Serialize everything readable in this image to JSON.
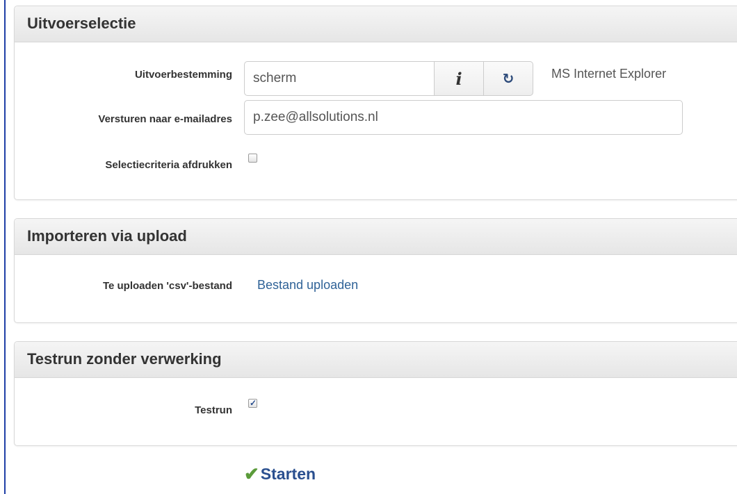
{
  "output_selection": {
    "title": "Uitvoerselectie",
    "destination_label": "Uitvoerbestemming",
    "destination_value": "scherm",
    "info_icon": "info-icon",
    "refresh_icon": "refresh-icon",
    "browser_text": "MS Internet Explorer",
    "email_label": "Versturen naar e-mailadres",
    "email_value": "p.zee@allsolutions.nl",
    "print_criteria_label": "Selectiecriteria afdrukken",
    "print_criteria_checked": false
  },
  "import_upload": {
    "title": "Importeren via upload",
    "file_label": "Te uploaden 'csv'-bestand",
    "upload_link": "Bestand uploaden"
  },
  "testrun": {
    "title": "Testrun zonder verwerking",
    "testrun_label": "Testrun",
    "testrun_checked": true
  },
  "actions": {
    "start_label": "Starten",
    "start_icon": "checkmark-icon"
  },
  "colors": {
    "link": "#2f6297",
    "start_label": "#2a4f8f",
    "start_check": "#5b9b3a",
    "left_border": "#1f3fa6"
  }
}
